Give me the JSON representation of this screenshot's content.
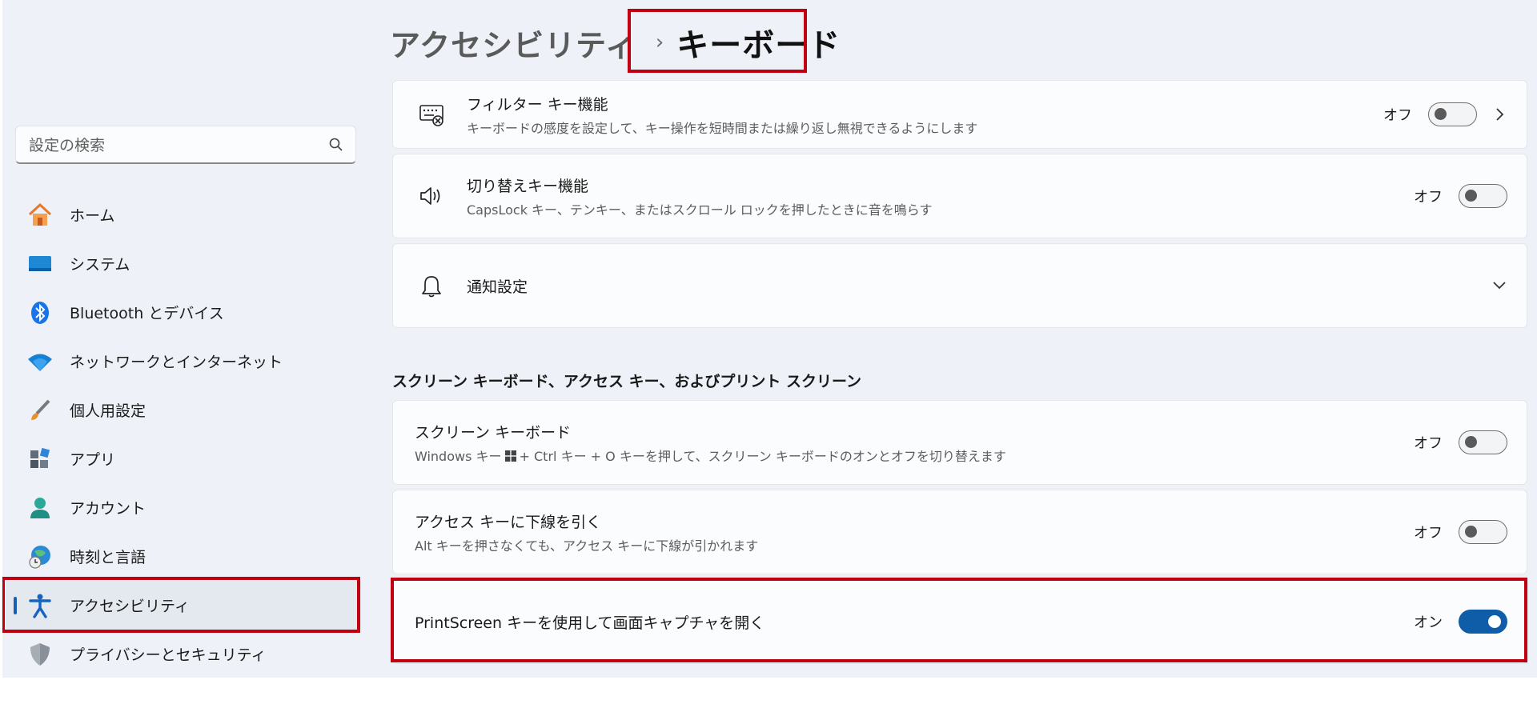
{
  "search": {
    "placeholder": "設定の検索"
  },
  "sidebar": {
    "items": [
      {
        "label": "ホーム",
        "icon": "home-icon"
      },
      {
        "label": "システム",
        "icon": "system-icon"
      },
      {
        "label": "Bluetooth とデバイス",
        "icon": "bluetooth-icon"
      },
      {
        "label": "ネットワークとインターネット",
        "icon": "wifi-icon"
      },
      {
        "label": "個人用設定",
        "icon": "brush-icon"
      },
      {
        "label": "アプリ",
        "icon": "apps-icon"
      },
      {
        "label": "アカウント",
        "icon": "account-icon"
      },
      {
        "label": "時刻と言語",
        "icon": "time-language-icon"
      },
      {
        "label": "アクセシビリティ",
        "icon": "accessibility-icon",
        "active": true
      },
      {
        "label": "プライバシーとセキュリティ",
        "icon": "shield-icon"
      }
    ]
  },
  "header": {
    "parent": "アクセシビリティ",
    "separator": "›",
    "current": "キーボード"
  },
  "cards": {
    "filter_keys": {
      "title": "フィルター キー機能",
      "desc": "キーボードの感度を設定して、キー操作を短時間または繰り返し無視できるようにします",
      "state": "オフ"
    },
    "toggle_keys": {
      "title": "切り替えキー機能",
      "desc": "CapsLock キー、テンキー、またはスクロール ロックを押したときに音を鳴らす",
      "state": "オフ"
    },
    "notifications": {
      "title": "通知設定"
    },
    "section_title": "スクリーン キーボード、アクセス キー、およびプリント スクリーン",
    "screen_keyboard": {
      "title": "スクリーン キーボード",
      "desc_pre": "Windows キー",
      "desc_post": "+ Ctrl キー + O キーを押して、スクリーン キーボードのオンとオフを切り替えます",
      "state": "オフ"
    },
    "access_keys": {
      "title": "アクセス キーに下線を引く",
      "desc": "Alt キーを押さなくても、アクセス キーに下線が引かれます",
      "state": "オフ"
    },
    "print_screen": {
      "title": "PrintScreen キーを使用して画面キャプチャを開く",
      "state": "オン"
    }
  },
  "colors": {
    "accent": "#0f5ca8",
    "highlight": "#c00010",
    "background": "#eef2f8"
  }
}
